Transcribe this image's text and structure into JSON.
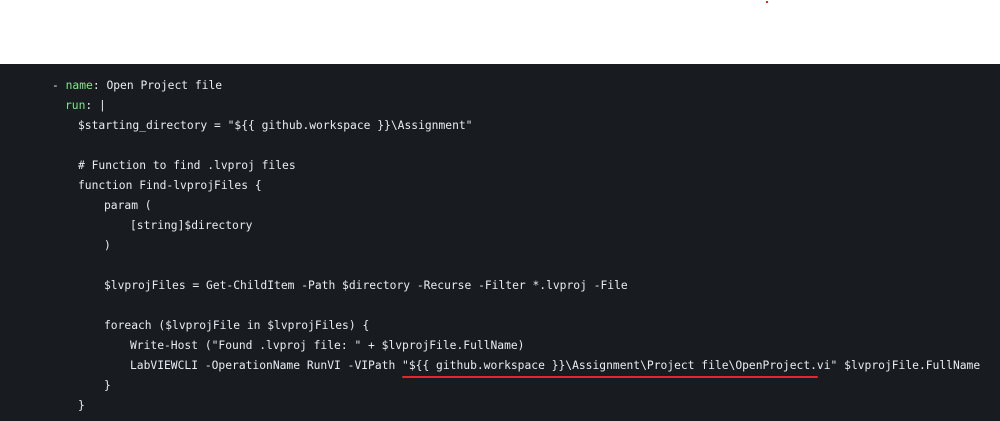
{
  "code": {
    "line1": {
      "dash": "- ",
      "key": "name",
      "sep": ": ",
      "value": "Open Project file"
    },
    "line2": {
      "key": "run",
      "sep": ": ",
      "value": "|"
    },
    "line3": "$starting_directory = \"${{ github.workspace }}\\Assignment\"",
    "line5": "# Function to find .lvproj files",
    "line6": "function Find-lvprojFiles {",
    "line7": "param (",
    "line8": "[string]$directory",
    "line9": ")",
    "line11": "$lvprojFiles = Get-ChildItem -Path $directory -Recurse -Filter *.lvproj -File",
    "line13": "foreach ($lvprojFile in $lvprojFiles) {",
    "line14": "Write-Host (\"Found .lvproj file: \" + $lvprojFile.FullName)",
    "line15": "LabVIEWCLI -OperationName RunVI -VIPath \"${{ github.workspace }}\\Assignment\\Project file\\OpenProject.vi\" $lvprojFile.FullName",
    "line16": "}",
    "line17": "}"
  },
  "colors": {
    "code_background": "#181b20",
    "code_text": "#e6edf3",
    "yaml_key": "#7ee787",
    "annotation_underline": "#e5262a"
  }
}
